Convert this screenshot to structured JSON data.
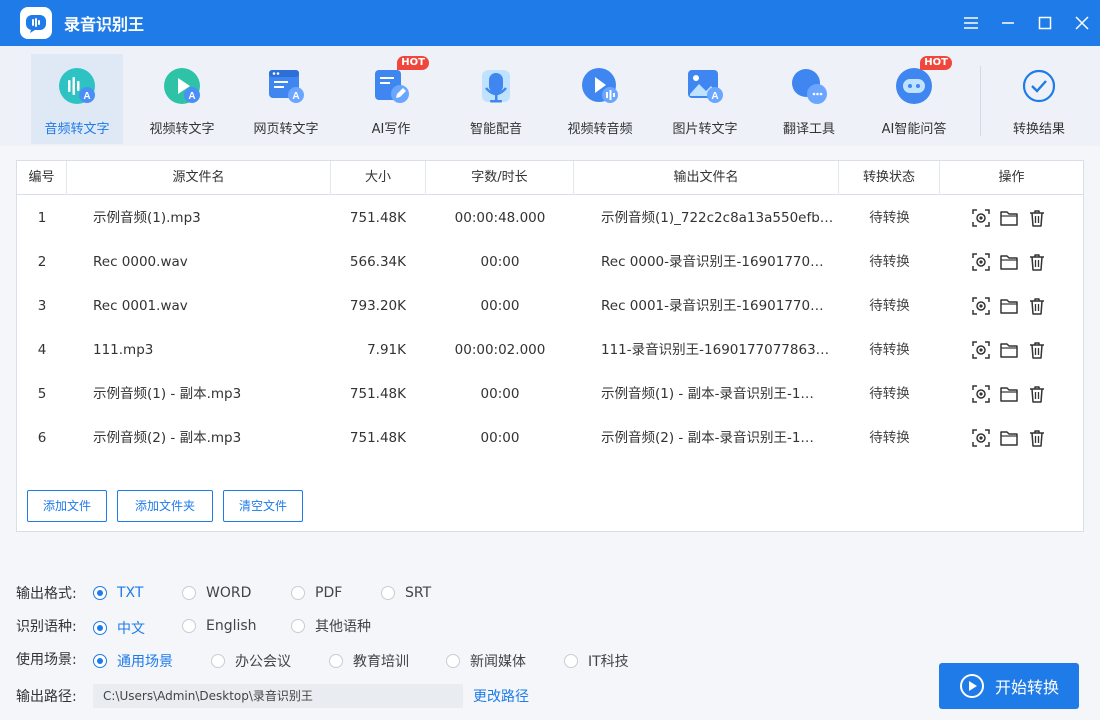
{
  "app": {
    "title": "录音识别王",
    "accent": "#1f7be8"
  },
  "toolbar": {
    "items": [
      {
        "label": "音频转文字",
        "icon": "audio-to-text-icon",
        "active": true
      },
      {
        "label": "视频转文字",
        "icon": "video-to-text-icon"
      },
      {
        "label": "网页转文字",
        "icon": "webpage-to-text-icon"
      },
      {
        "label": "AI写作",
        "icon": "ai-writing-icon",
        "badge": "HOT"
      },
      {
        "label": "智能配音",
        "icon": "microphone-icon"
      },
      {
        "label": "视频转音频",
        "icon": "video-to-audio-icon"
      },
      {
        "label": "图片转文字",
        "icon": "image-to-text-icon"
      },
      {
        "label": "翻译工具",
        "icon": "translate-icon"
      },
      {
        "label": "AI智能问答",
        "icon": "ai-chat-icon",
        "badge": "HOT"
      },
      {
        "label": "转换结果",
        "icon": "check-circle-icon"
      }
    ]
  },
  "table": {
    "headers": [
      "编号",
      "源文件名",
      "大小",
      "字数/时长",
      "输出文件名",
      "转换状态",
      "操作"
    ],
    "rows": [
      {
        "no": "1",
        "src": "示例音频(1).mp3",
        "size": "751.48K",
        "dur": "00:00:48.000",
        "out": "示例音频(1)_722c2c8a13a550efb…",
        "status": "待转换"
      },
      {
        "no": "2",
        "src": "Rec 0000.wav",
        "size": "566.34K",
        "dur": "00:00",
        "out": "Rec 0000-录音识别王-16901770…",
        "status": "待转换"
      },
      {
        "no": "3",
        "src": "Rec 0001.wav",
        "size": "793.20K",
        "dur": "00:00",
        "out": "Rec 0001-录音识别王-16901770…",
        "status": "待转换"
      },
      {
        "no": "4",
        "src": "111.mp3",
        "size": "7.91K",
        "dur": "00:00:02.000",
        "out": "111-录音识别王-1690177077863…",
        "status": "待转换"
      },
      {
        "no": "5",
        "src": "示例音频(1) - 副本.mp3",
        "size": "751.48K",
        "dur": "00:00",
        "out": "示例音频(1) - 副本-录音识别王-1…",
        "status": "待转换"
      },
      {
        "no": "6",
        "src": "示例音频(2) - 副本.mp3",
        "size": "751.48K",
        "dur": "00:00",
        "out": "示例音频(2) - 副本-录音识别王-1…",
        "status": "待转换"
      }
    ]
  },
  "panel_buttons": {
    "add_file": "添加文件",
    "add_folder": "添加文件夹",
    "clear": "清空文件"
  },
  "options": {
    "format": {
      "label": "输出格式:",
      "choices": [
        "TXT",
        "WORD",
        "PDF",
        "SRT"
      ],
      "selected": "TXT"
    },
    "language": {
      "label": "识别语种:",
      "choices": [
        "中文",
        "English",
        "其他语种"
      ],
      "selected": "中文"
    },
    "scene": {
      "label": "使用场景:",
      "choices": [
        "通用场景",
        "办公会议",
        "教育培训",
        "新闻媒体",
        "IT科技"
      ],
      "selected": "通用场景"
    },
    "path": {
      "label": "输出路径:",
      "value": "C:\\Users\\Admin\\Desktop\\录音识别王",
      "change": "更改路径"
    }
  },
  "start_button": "开始转换"
}
